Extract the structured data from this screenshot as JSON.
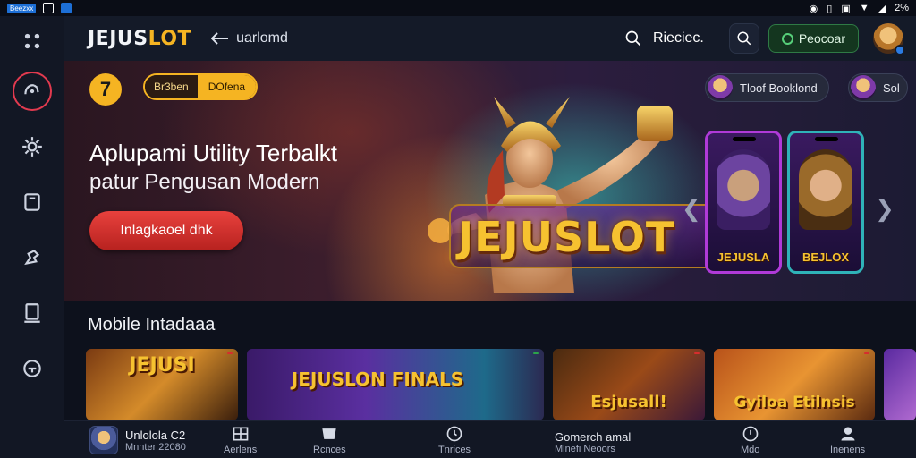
{
  "status_bar": {
    "left_chip": "Beezxx",
    "right_battery": "2%"
  },
  "header": {
    "logo_main": "JEJUS",
    "logo_accent": "LOT",
    "back_label": "uarlomd",
    "search_label": "Rieciec.",
    "green_button": "Peocoar"
  },
  "hero": {
    "badge_number": "7",
    "pill_left": "Br3ben",
    "pill_right": "DOfena",
    "title": "Aplupami Utility Terbalkt",
    "subtitle": "patur Pengusan Modern",
    "cta": "Inlagkaoel dhk",
    "logo_text": "JEJUSLOT",
    "user_pill_1": "Tloof Booklond",
    "user_pill_2": "Sol",
    "phones": [
      "JEJUSLA",
      "BEJLOX"
    ]
  },
  "section": {
    "title": "Mobile Intadaaa",
    "cards": [
      "JEJUSI",
      "JEJUSLON FINALS",
      "Esjusall!",
      "Gyiloa Etilnsis"
    ]
  },
  "bottom_nav": {
    "user_name": "Unlolola C2",
    "user_sub": "Mnnter 22080",
    "items": [
      "Aerlens",
      "Rcnces",
      "Tnrices",
      "Mdo",
      "Inenens"
    ],
    "center_title": "Gomerch amal",
    "center_sub": "Mlnefi Neoors"
  },
  "colors": {
    "accent": "#f5b422",
    "cta": "#e23a3a",
    "active_ring": "#e23a4f",
    "green": "#57d07a"
  }
}
